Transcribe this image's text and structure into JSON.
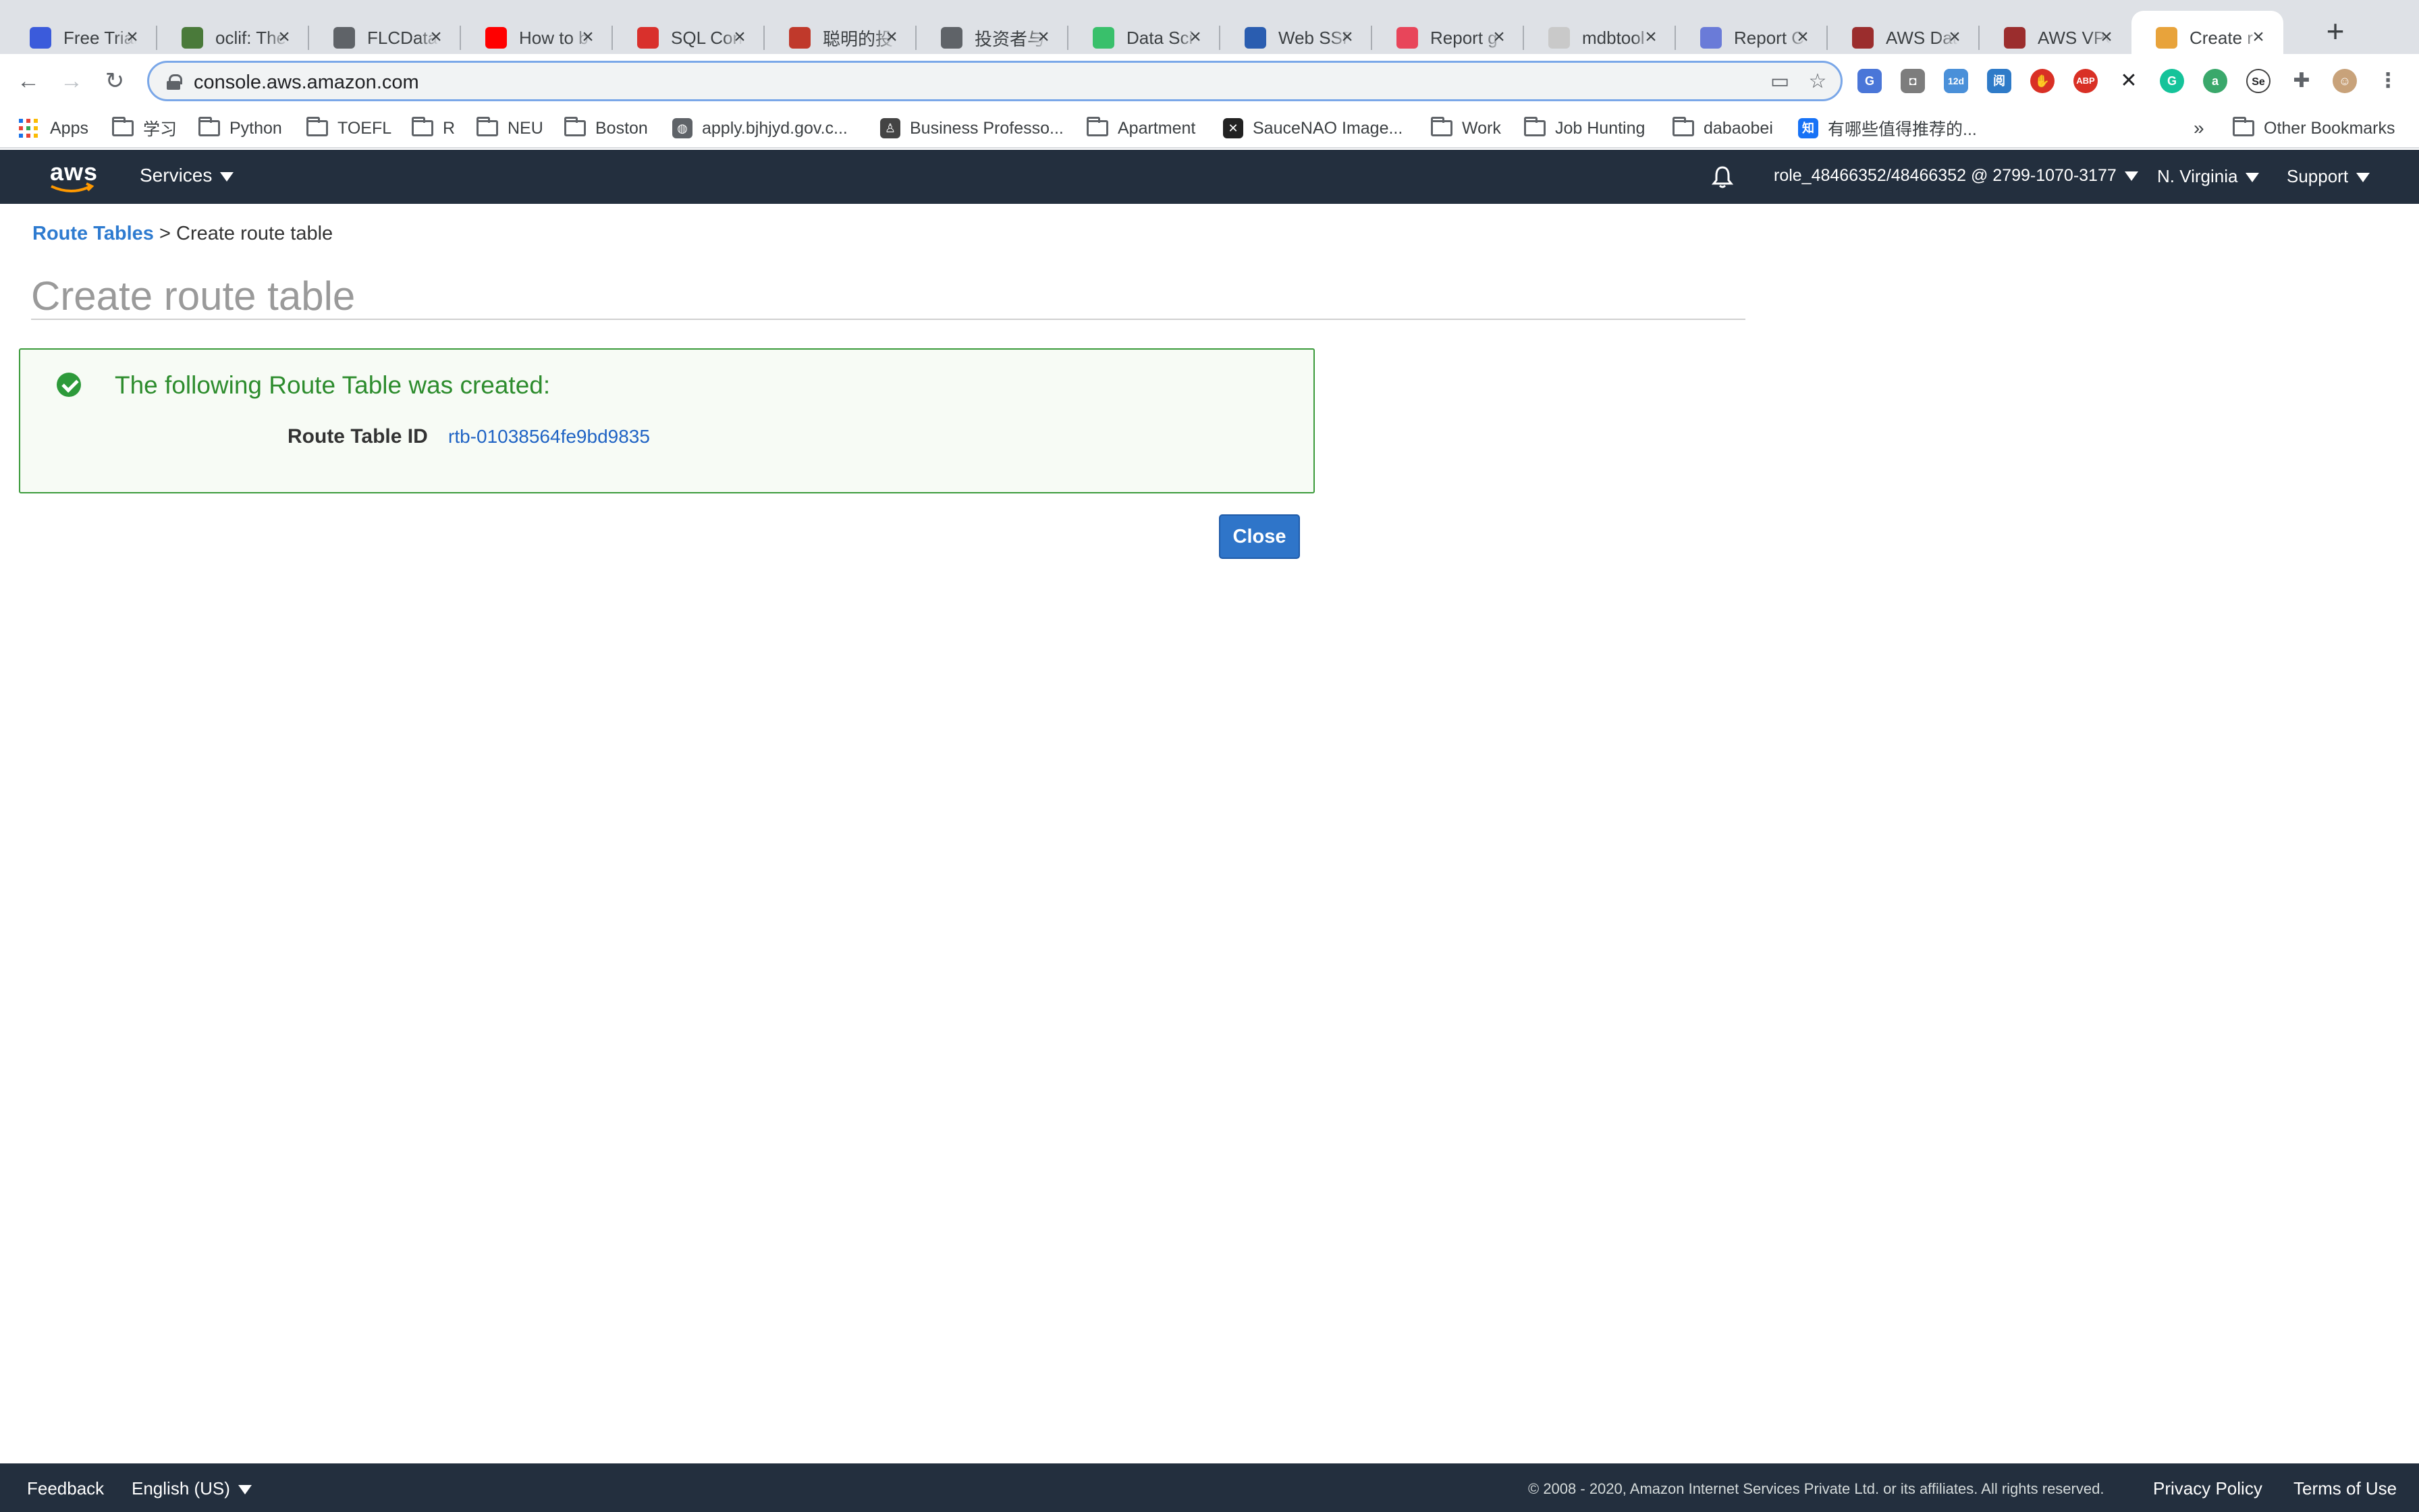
{
  "browser": {
    "tabs": [
      {
        "title": "Free Trial",
        "icon": "globe-blue-icon",
        "color": "#3b5bdb"
      },
      {
        "title": "oclif: The",
        "icon": "leaf-icon",
        "color": "#4a7a3a"
      },
      {
        "title": "FLCData",
        "icon": "globe-icon",
        "color": "#5f6368"
      },
      {
        "title": "How to b",
        "icon": "youtube-icon",
        "color": "#ff0000"
      },
      {
        "title": "SQL Con",
        "icon": "sql-icon",
        "color": "#d9302c"
      },
      {
        "title": "聪明的投",
        "icon": "bull-icon",
        "color": "#c0392b"
      },
      {
        "title": "投资者与",
        "icon": "globe-icon",
        "color": "#5f6368"
      },
      {
        "title": "Data Sci",
        "icon": "dc-icon",
        "color": "#39c06b"
      },
      {
        "title": "Web SSR",
        "icon": "check-doc-icon",
        "color": "#2a5db0"
      },
      {
        "title": "Report g",
        "icon": "report-icon",
        "color": "#e8455a"
      },
      {
        "title": "mdbtool",
        "icon": "github-icon",
        "color": "#c9c9c9"
      },
      {
        "title": "Report C",
        "icon": "pinwheel-icon",
        "color": "#6a7bd8"
      },
      {
        "title": "AWS Dat",
        "icon": "aws-red-icon",
        "color": "#9b2d2d"
      },
      {
        "title": "AWS VPC",
        "icon": "aws-red-icon",
        "color": "#9b2d2d"
      },
      {
        "title": "Create r",
        "icon": "aws-box-icon",
        "color": "#e8a33b"
      }
    ],
    "url": "console.aws.amazon.com",
    "bookmarks": [
      {
        "label": "Apps",
        "type": "apps"
      },
      {
        "label": "学习",
        "type": "folder"
      },
      {
        "label": "Python",
        "type": "folder"
      },
      {
        "label": "TOEFL",
        "type": "folder"
      },
      {
        "label": "R",
        "type": "folder"
      },
      {
        "label": "NEU",
        "type": "folder"
      },
      {
        "label": "Boston",
        "type": "folder"
      },
      {
        "label": "apply.bjhjyd.gov.c...",
        "type": "globe"
      },
      {
        "label": "Business Professo...",
        "type": "person"
      },
      {
        "label": "Apartment",
        "type": "folder"
      },
      {
        "label": "SauceNAO Image...",
        "type": "x"
      },
      {
        "label": "Work",
        "type": "folder"
      },
      {
        "label": "Job Hunting",
        "type": "folder"
      },
      {
        "label": "dabaobei",
        "type": "folder"
      },
      {
        "label": "有哪些值得推荐的...",
        "type": "zhihu"
      }
    ],
    "bookmarks_overflow": "»",
    "other_bookmarks": "Other Bookmarks"
  },
  "aws_header": {
    "logo_text": "aws",
    "services_label": "Services",
    "account_label": "role_48466352/48466352 @ 2799-1070-3177",
    "region_label": "N. Virginia",
    "support_label": "Support"
  },
  "breadcrumb": {
    "parent_label": "Route Tables",
    "separator": ">",
    "current_label": "Create route table"
  },
  "page": {
    "title": "Create route table"
  },
  "success_alert": {
    "message": "The following Route Table was created:",
    "id_label": "Route Table ID",
    "id_value": "rtb-01038564fe9bd9835"
  },
  "actions": {
    "close_label": "Close"
  },
  "footer": {
    "feedback_label": "Feedback",
    "language_label": "English (US)",
    "copyright": "© 2008 - 2020, Amazon Internet Services Private Ltd. or its affiliates. All rights reserved.",
    "privacy_label": "Privacy Policy",
    "terms_label": "Terms of Use"
  },
  "colors": {
    "aws_nav_bg": "#232f3e",
    "aws_orange": "#ff9900",
    "success_green": "#2d8c2d",
    "link_blue": "#1f63c4",
    "button_blue": "#2f75c9"
  }
}
